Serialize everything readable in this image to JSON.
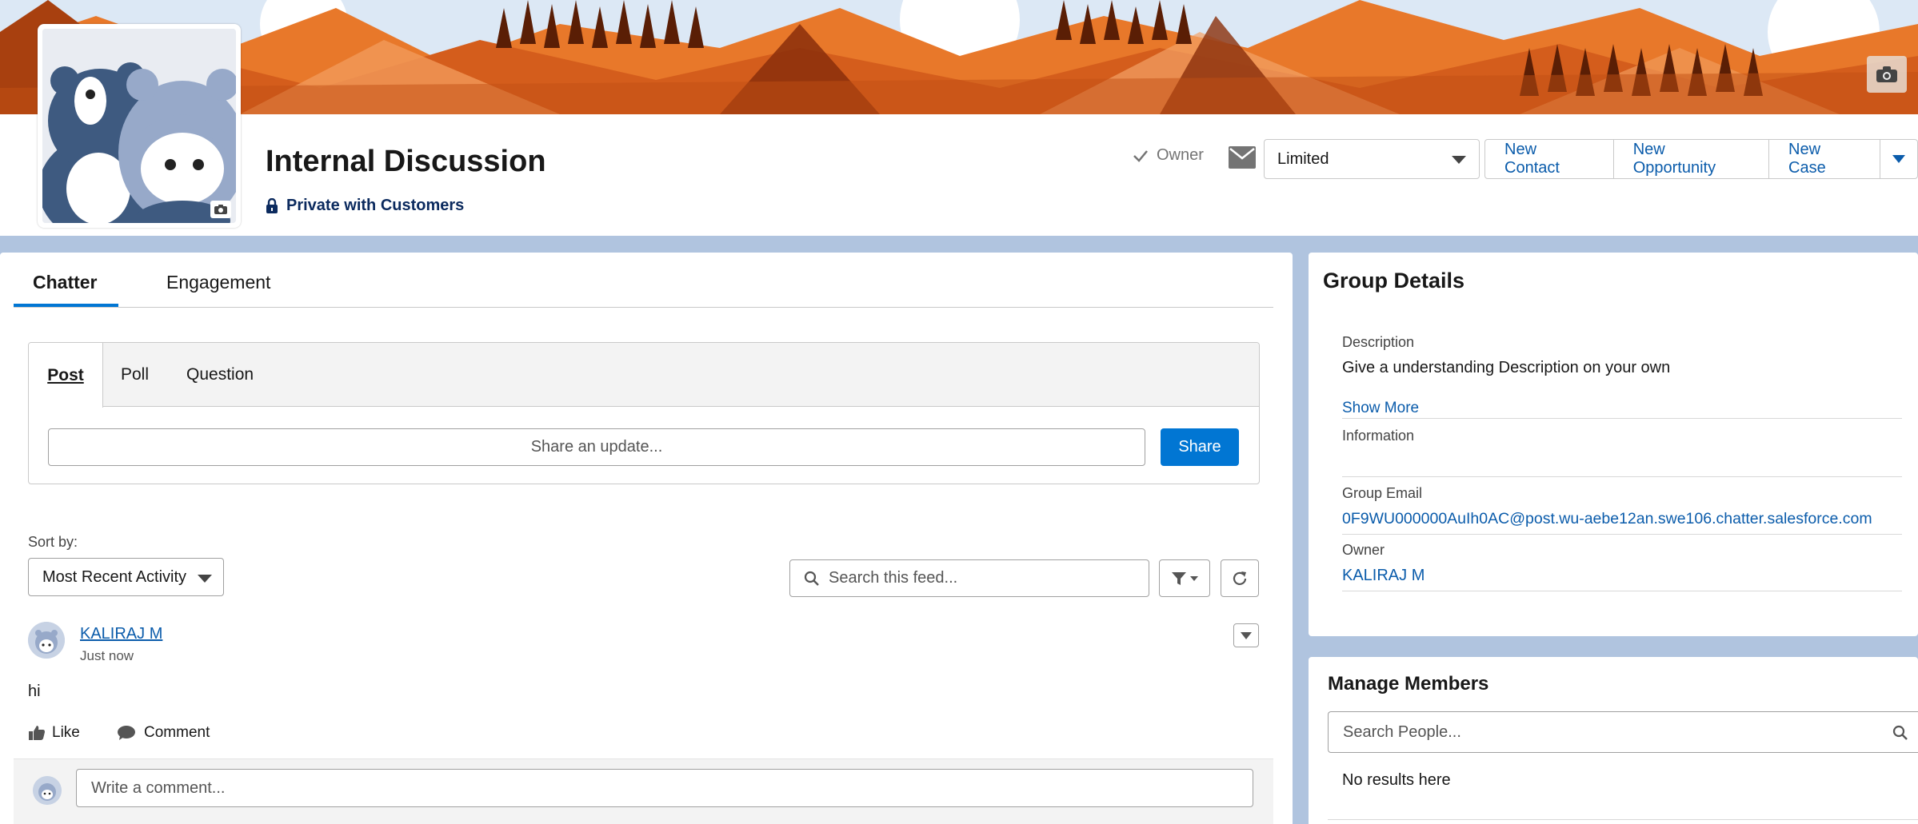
{
  "group": {
    "title": "Internal Discussion",
    "privacy": "Private with Customers"
  },
  "header": {
    "owner_flag": "Owner",
    "email_setting": "Limited",
    "actions": [
      "New Contact",
      "New Opportunity",
      "New Case"
    ]
  },
  "tabs": {
    "chatter": "Chatter",
    "engagement": "Engagement"
  },
  "publisher": {
    "tabs": [
      "Post",
      "Poll",
      "Question"
    ],
    "placeholder": "Share an update...",
    "share_label": "Share"
  },
  "feed": {
    "sort_label": "Sort by:",
    "sort_value": "Most Recent Activity",
    "search_placeholder": "Search this feed...",
    "post": {
      "author": "KALIRAJ M",
      "time": "Just now",
      "body": "hi",
      "like_label": "Like",
      "comment_label": "Comment",
      "comment_placeholder": "Write a comment..."
    }
  },
  "group_details": {
    "title": "Group Details",
    "description_label": "Description",
    "description": "Give a understanding Description on your own",
    "show_more": "Show More",
    "information_label": "Information",
    "email_label": "Group Email",
    "email": "0F9WU000000AuIh0AC@post.wu-aebe12an.swe106.chatter.salesforce.com",
    "owner_label": "Owner",
    "owner": "KALIRAJ M"
  },
  "manage_members": {
    "title": "Manage Members",
    "search_placeholder": "Search People...",
    "no_results": "No results here"
  },
  "colors": {
    "brand_blue": "#0176d3",
    "link_blue": "#0b5cab",
    "page_bg": "#b0c4df"
  }
}
